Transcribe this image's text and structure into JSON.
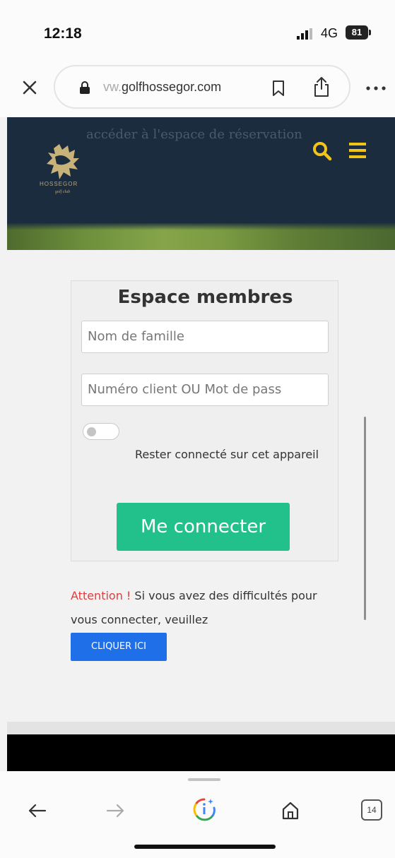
{
  "status_bar": {
    "time": "12:18",
    "network": "4G",
    "battery": "81"
  },
  "browser": {
    "url_prefix": "vw.",
    "url_domain": "golfhossegor.com"
  },
  "header": {
    "overlay_text": "accéder à l'espace de réservation",
    "logo_text": "HOSSEGOR",
    "logo_sub": "golf club"
  },
  "login": {
    "title": "Espace membres",
    "name_placeholder": "Nom de famille",
    "password_placeholder": "Numéro client OU Mot de pass",
    "remember_label": "Rester connecté sur cet appareil",
    "remember_on": false,
    "submit_label": "Me connecter"
  },
  "notice": {
    "warning_word": "Attention !",
    "message": " Si vous avez des difficultés pour vous connecter, veuillez",
    "button_label": "CLIQUER ICI"
  },
  "toolbar": {
    "tab_count": "14"
  },
  "colors": {
    "header_bg": "#1c2c3f",
    "accent_yellow": "#f2c417",
    "connect_green": "#22c08a",
    "link_blue": "#1e6fe8",
    "warning_red": "#e63a3a"
  }
}
